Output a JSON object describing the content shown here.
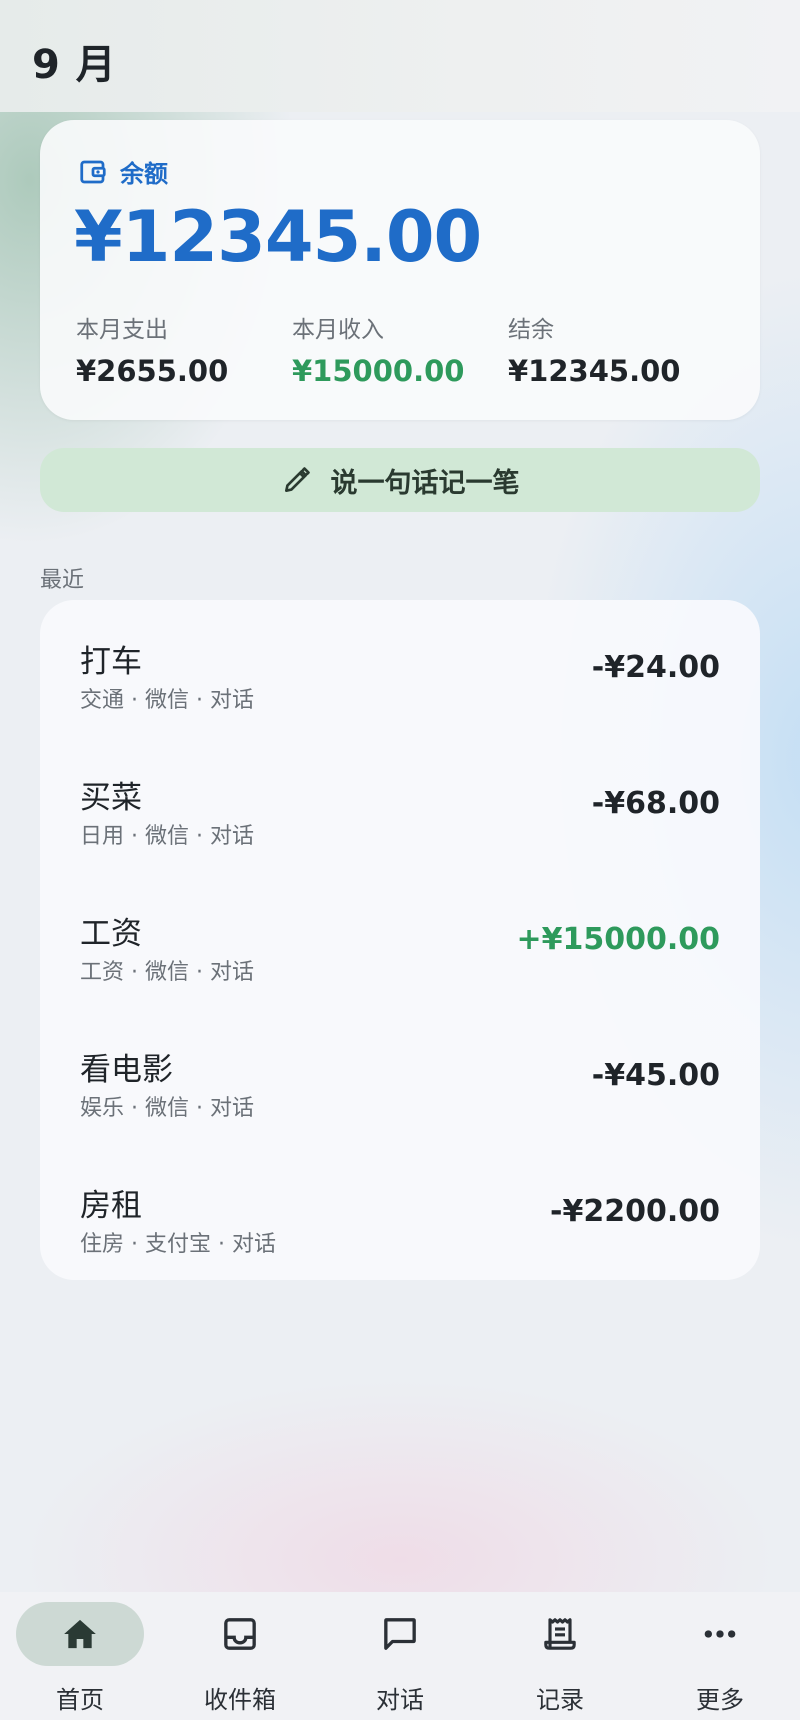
{
  "header": {
    "month": "9 月"
  },
  "balance": {
    "label": "余额",
    "amount": "¥12345.00",
    "stats": [
      {
        "label": "本月支出",
        "value": "¥2655.00"
      },
      {
        "label": "本月收入",
        "value": "¥15000.00"
      },
      {
        "label": "结余",
        "value": "¥12345.00"
      }
    ]
  },
  "quick_record": {
    "label": "说一句话记一笔"
  },
  "recent": {
    "title": "最近",
    "items": [
      {
        "title": "打车",
        "meta": "交通 · 微信 · 对话",
        "amount": "-¥24.00"
      },
      {
        "title": "买菜",
        "meta": "日用 · 微信 · 对话",
        "amount": "-¥68.00"
      },
      {
        "title": "工资",
        "meta": "工资 · 微信 · 对话",
        "amount": "+¥15000.00"
      },
      {
        "title": "看电影",
        "meta": "娱乐 · 微信 · 对话",
        "amount": "-¥45.00"
      },
      {
        "title": "房租",
        "meta": "住房 · 支付宝 · 对话",
        "amount": "-¥2200.00"
      }
    ]
  },
  "nav": {
    "active": "home",
    "items": [
      {
        "label": "首页",
        "icon": "home-icon"
      },
      {
        "label": "收件箱",
        "icon": "inbox-icon"
      },
      {
        "label": "对话",
        "icon": "chat-icon"
      },
      {
        "label": "记录",
        "icon": "receipt-icon"
      },
      {
        "label": "更多",
        "icon": "more-icon"
      }
    ]
  },
  "colors": {
    "accent": "#1f6cc8",
    "income": "#2e9a5c",
    "quick_record_bg": "#d1e8d6",
    "nav_active_pill": "#cdd9d4"
  }
}
